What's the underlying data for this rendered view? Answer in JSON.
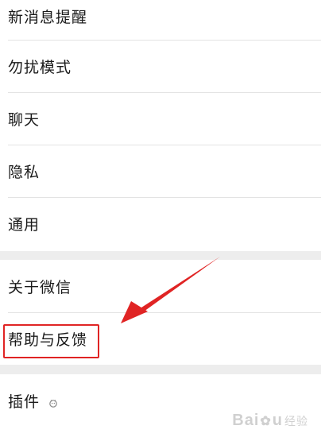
{
  "settings": {
    "group1": [
      {
        "label": "新消息提醒"
      },
      {
        "label": "勿扰模式"
      },
      {
        "label": "聊天"
      },
      {
        "label": "隐私"
      },
      {
        "label": "通用"
      }
    ],
    "group2": [
      {
        "label": "关于微信"
      },
      {
        "label": "帮助与反馈"
      }
    ],
    "group3": [
      {
        "label": "插件",
        "icon": "plugin-icon"
      }
    ]
  },
  "annotation": {
    "highlight_color": "#e02424",
    "arrow_color": "#e02424"
  },
  "watermark": {
    "brand_left": "Bai",
    "brand_right": "u",
    "brand_sub": "经验"
  },
  "colors": {
    "background": "#ededed",
    "row_bg": "#ffffff",
    "divider": "#e3e3e3",
    "text": "#1a1a1a"
  }
}
